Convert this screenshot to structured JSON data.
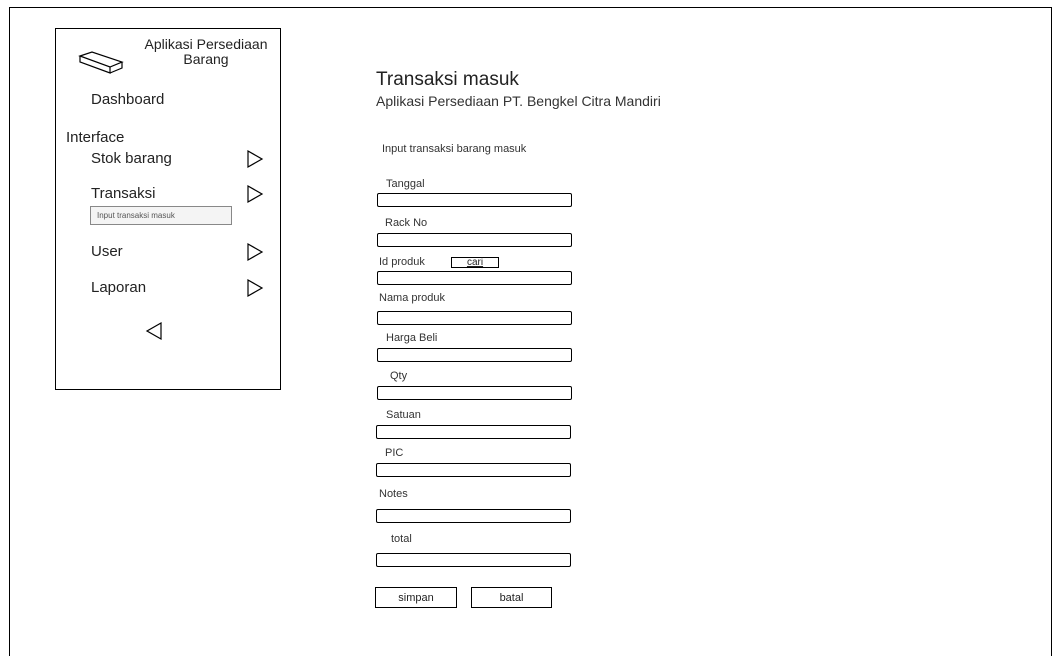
{
  "sidebar": {
    "app_name": "Aplikasi Persediaan Barang",
    "icon": "box-icon",
    "dashboard": "Dashboard",
    "section": "Interface",
    "items": [
      {
        "label": "Stok barang",
        "icon": "triangle-right-icon"
      },
      {
        "label": "Transaksi",
        "icon": "triangle-right-icon"
      },
      {
        "label": "User",
        "icon": "triangle-right-icon"
      },
      {
        "label": "Laporan",
        "icon": "triangle-right-icon"
      }
    ],
    "submenu": "Input transaksi masuk",
    "collapse_icon": "triangle-left-icon"
  },
  "header": {
    "title": "Transaksi masuk",
    "subtitle": "Aplikasi Persediaan PT. Bengkel Citra Mandiri"
  },
  "form": {
    "section_label": "Input transaksi barang masuk",
    "fields": [
      {
        "label": "Tanggal",
        "value": ""
      },
      {
        "label": "Rack No",
        "value": ""
      },
      {
        "label": "Id produk",
        "value": ""
      },
      {
        "label": "Nama produk",
        "value": ""
      },
      {
        "label": "Harga Beli",
        "value": ""
      },
      {
        "label": "Qty",
        "value": ""
      },
      {
        "label": "Satuan",
        "value": ""
      },
      {
        "label": "PIC",
        "value": ""
      },
      {
        "label": "Notes",
        "value": ""
      },
      {
        "label": "total",
        "value": ""
      }
    ],
    "search_button": "cari",
    "save_button": "simpan",
    "cancel_button": "batal"
  }
}
